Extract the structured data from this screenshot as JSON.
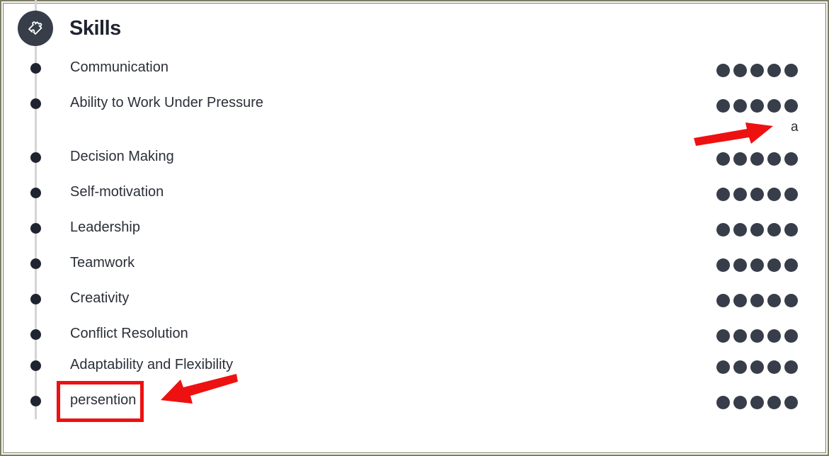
{
  "section": {
    "title": "Skills",
    "icon": "puzzle-piece-icon"
  },
  "skills": [
    {
      "name": "Communication",
      "rating": 5,
      "max": 5
    },
    {
      "name": "Ability to Work Under Pressure",
      "rating": 5,
      "max": 5
    },
    {
      "name": "Decision Making",
      "rating": 5,
      "max": 5
    },
    {
      "name": "Self-motivation",
      "rating": 5,
      "max": 5
    },
    {
      "name": "Leadership",
      "rating": 5,
      "max": 5
    },
    {
      "name": "Teamwork",
      "rating": 5,
      "max": 5
    },
    {
      "name": "Creativity",
      "rating": 5,
      "max": 5
    },
    {
      "name": "Conflict Resolution",
      "rating": 5,
      "max": 5
    },
    {
      "name": "Adaptability and Flexibility",
      "rating": 5,
      "max": 5
    },
    {
      "name": "persention",
      "rating": 5,
      "max": 5
    }
  ],
  "annotations": {
    "stray_char": "a",
    "highlighted_skill": "persention",
    "arrow_color": "#ee1111"
  },
  "colors": {
    "dot_filled": "#373d49",
    "bullet": "#1f2430",
    "timeline": "#d4d4d4",
    "frame": "#7c7c64"
  }
}
